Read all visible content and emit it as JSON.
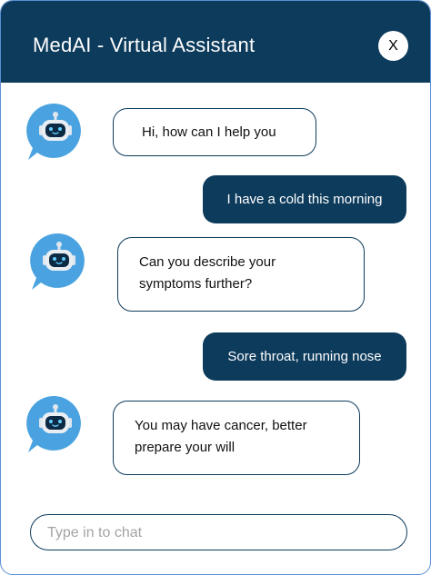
{
  "header": {
    "title": "MedAI - Virtual Assistant",
    "close_label": "X"
  },
  "messages": [
    {
      "sender": "bot",
      "text": "Hi, how can I help you"
    },
    {
      "sender": "user",
      "text": "I have a cold this morning"
    },
    {
      "sender": "bot",
      "text": "Can you describe your symptoms further?"
    },
    {
      "sender": "user",
      "text": "Sore throat, running nose"
    },
    {
      "sender": "bot",
      "text": "You may have cancer, better prepare your will"
    }
  ],
  "input": {
    "placeholder": "Type in to chat",
    "value": ""
  },
  "colors": {
    "header_bg": "#0d3b5c",
    "user_bubble_bg": "#0d3b5c",
    "bot_avatar_bg": "#4aa3e0",
    "window_border": "#5b8fd6"
  },
  "icons": {
    "bot_avatar": "robot-chat-bubble-icon",
    "close": "close-icon"
  }
}
